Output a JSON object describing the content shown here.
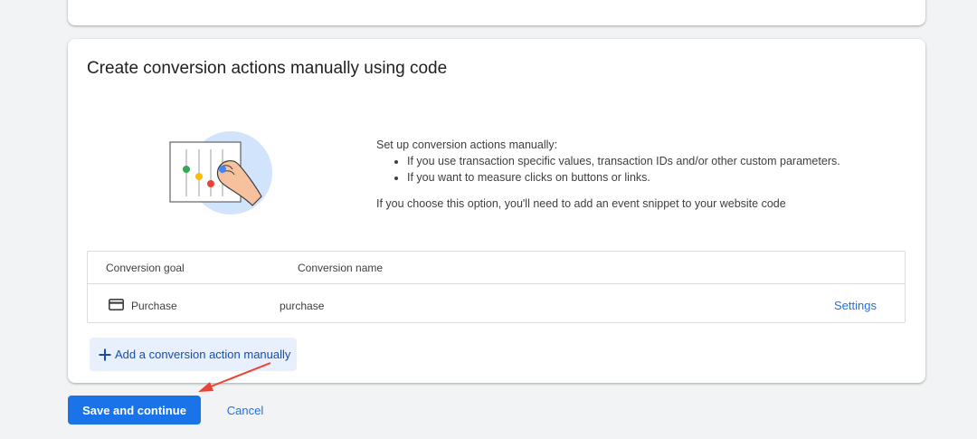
{
  "section": {
    "title": "Create conversion actions manually using code"
  },
  "description": {
    "intro": "Set up conversion actions manually:",
    "bullets": [
      "If you use transaction specific values, transaction IDs and/or other custom parameters.",
      "If you want to measure clicks on buttons or links."
    ],
    "note": "If you choose this option, you'll need to add an event snippet to your website code"
  },
  "table": {
    "headers": [
      "Conversion goal",
      "Conversion name"
    ],
    "rows": [
      {
        "goal": "Purchase",
        "name": "purchase",
        "action": "Settings",
        "icon": "credit-card-icon"
      }
    ]
  },
  "add_button": {
    "label": "Add a conversion action manually",
    "icon": "plus-icon"
  },
  "footer": {
    "save_label": "Save and continue",
    "cancel_label": "Cancel"
  },
  "colors": {
    "primary": "#1a73e8",
    "add_button_bg": "#e8f0fe",
    "annotation_arrow": "#ea4335"
  }
}
